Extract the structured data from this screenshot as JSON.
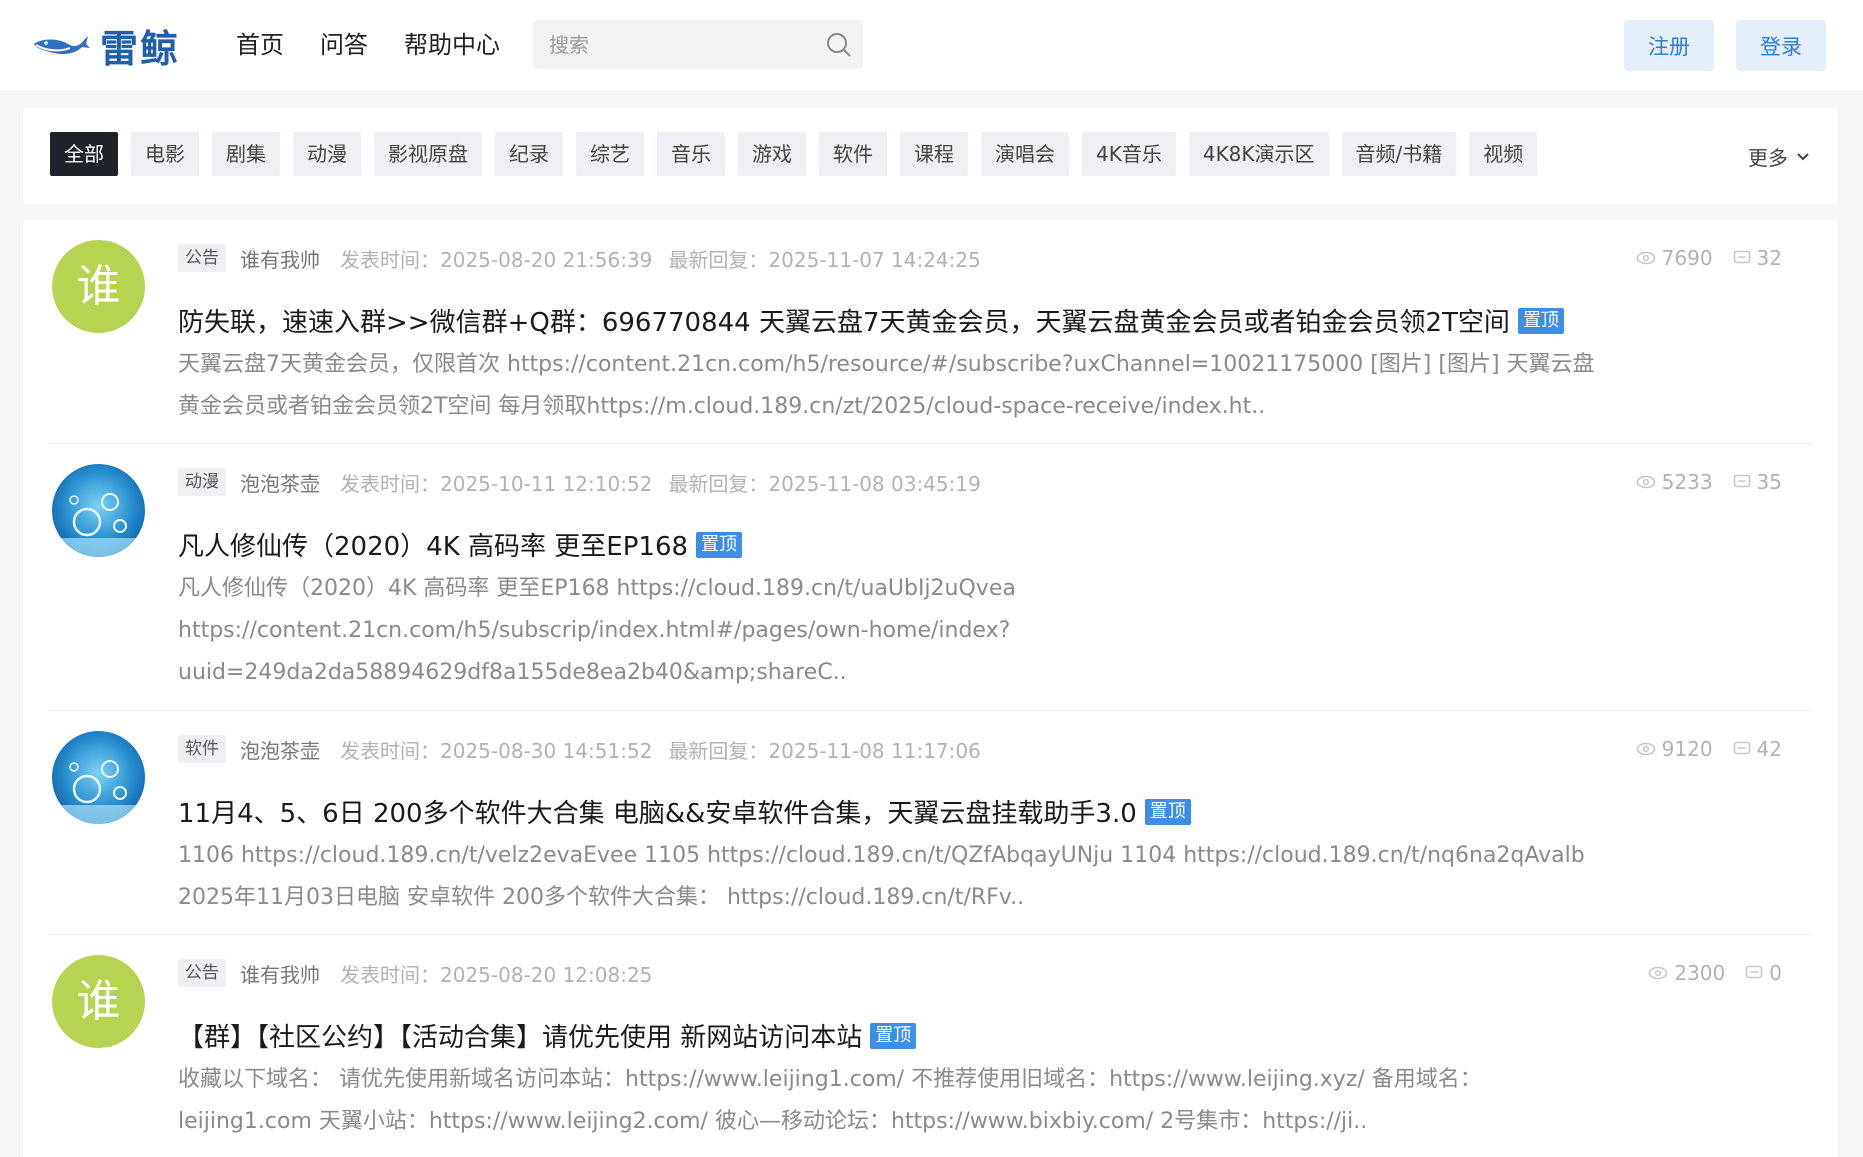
{
  "header": {
    "logo_text": "雷鲸",
    "nav": [
      "首页",
      "问答",
      "帮助中心"
    ],
    "search_placeholder": "搜索",
    "register_label": "注册",
    "login_label": "登录"
  },
  "categories": {
    "items": [
      "全部",
      "电影",
      "剧集",
      "动漫",
      "影视原盘",
      "纪录",
      "综艺",
      "音乐",
      "游戏",
      "软件",
      "课程",
      "演唱会",
      "4K音乐",
      "4K8K演示区",
      "音频/书籍",
      "视频"
    ],
    "active": "全部",
    "more_label": "更多"
  },
  "posts": [
    {
      "avatar_text": "谁",
      "avatar_type": "letter",
      "tag": "公告",
      "author": "谁有我帅",
      "posted": "发表时间：2025-08-20 21:56:39",
      "replied": "最新回复：2025-11-07 14:24:25",
      "views": "7690",
      "comments": "32",
      "title": "防失联，速速入群>>微信群+Q群：696770844 天翼云盘7天黄金会员，天翼云盘黄金会员或者铂金会员领2T空间",
      "pin": "置顶",
      "excerpt": [
        "天翼云盘7天黄金会员，仅限首次 https://content.21cn.com/h5/resource/#/subscribe?uxChannel=10021175000 [图片] [图片] 天翼云盘",
        "黄金会员或者铂金会员领2T空间 每月领取https://m.cloud.189.cn/zt/2025/cloud-space-receive/index.ht.."
      ]
    },
    {
      "avatar_text": "",
      "avatar_type": "bubbles",
      "tag": "动漫",
      "author": "泡泡茶壶",
      "posted": "发表时间：2025-10-11 12:10:52",
      "replied": "最新回复：2025-11-08 03:45:19",
      "views": "5233",
      "comments": "35",
      "title": "凡人修仙传（2020）4K 高码率 更至EP168",
      "pin": "置顶",
      "excerpt": [
        "凡人修仙传（2020）4K 高码率 更至EP168 https://cloud.189.cn/t/uaUbIj2uQvea",
        "https://content.21cn.com/h5/subscrip/index.html#/pages/own-home/index?",
        "uuid=249da2da58894629df8a155de8ea2b40&amp;shareC.."
      ]
    },
    {
      "avatar_text": "",
      "avatar_type": "bubbles",
      "tag": "软件",
      "author": "泡泡茶壶",
      "posted": "发表时间：2025-08-30 14:51:52",
      "replied": "最新回复：2025-11-08 11:17:06",
      "views": "9120",
      "comments": "42",
      "title": "11月4、5、6日 200多个软件大合集 电脑&&安卓软件合集，天翼云盘挂载助手3.0",
      "pin": "置顶",
      "excerpt": [
        "1106 https://cloud.189.cn/t/velz2evaEvee 1105 https://cloud.189.cn/t/QZfAbqayUNju 1104 https://cloud.189.cn/t/nq6na2qAvalb",
        "2025年11月03日电脑 安卓软件 200多个软件大合集：  https://cloud.189.cn/t/RFv.."
      ]
    },
    {
      "avatar_text": "谁",
      "avatar_type": "letter",
      "tag": "公告",
      "author": "谁有我帅",
      "posted": "发表时间：2025-08-20 12:08:25",
      "replied": "",
      "views": "2300",
      "comments": "0",
      "title": "【群】【社区公约】【活动合集】请优先使用 新网站访问本站",
      "pin": "置顶",
      "excerpt": [
        "收藏以下域名：  请优先使用新域名访问本站：https://www.leijing1.com/ 不推荐使用旧域名：https://www.leijing.xyz/ 备用域名：",
        "leijing1.com 天翼小站：https://www.leijing2.com/ 彼心—移动论坛：https://www.bixbiy.com/ 2号集市：https://ji.."
      ]
    }
  ]
}
